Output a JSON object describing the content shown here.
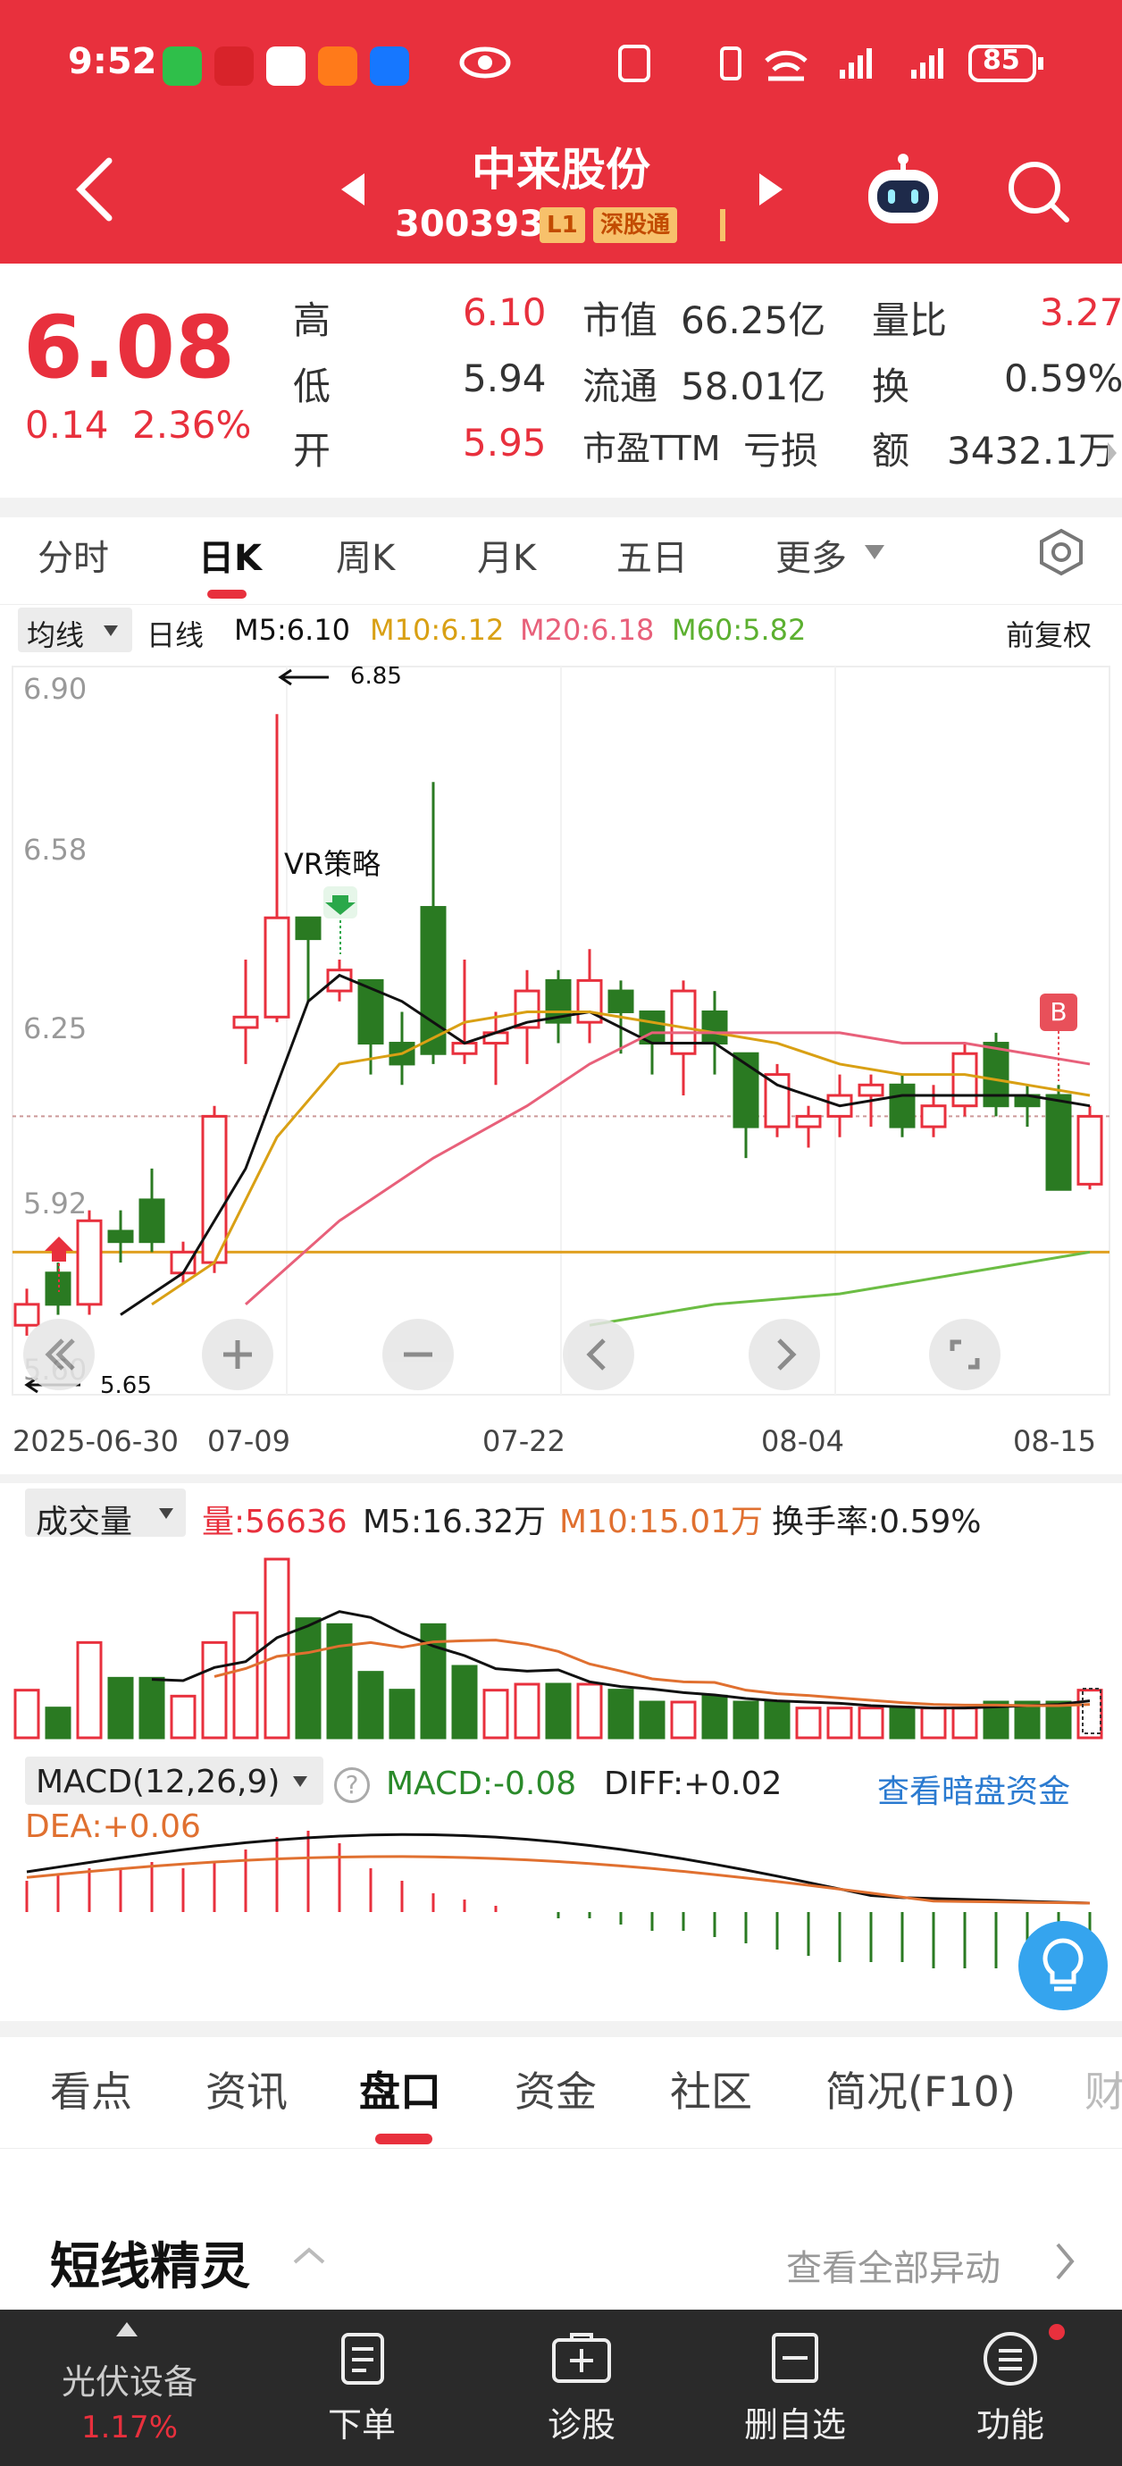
{
  "status": {
    "time": "9:52",
    "battery": "85"
  },
  "header": {
    "title": "中来股份",
    "code": "300393",
    "tag_level": "L1",
    "tag_market": "深股通"
  },
  "quote": {
    "price": "6.08",
    "change": "0.14",
    "change_pct": "2.36%",
    "high_label": "高",
    "high": "6.10",
    "low_label": "低",
    "low": "5.94",
    "open_label": "开",
    "open": "5.95",
    "mcap_label": "市值",
    "mcap": "66.25亿",
    "float_label": "流通",
    "float": "58.01亿",
    "pe_label": "市盈TTM",
    "pe": "亏损",
    "vr_label": "量比",
    "vr": "3.27",
    "turn_label": "换",
    "turn": "0.59%",
    "amt_label": "额",
    "amt": "3432.1万"
  },
  "chart_tabs": [
    "分时",
    "日K",
    "周K",
    "月K",
    "五日",
    "更多"
  ],
  "ma_bar": {
    "indicator": "均线",
    "type": "日线",
    "m5": "M5:6.10",
    "m10": "M10:6.12",
    "m20": "M20:6.18",
    "m60": "M60:5.82",
    "adjust": "前复权"
  },
  "colors": {
    "up": "#e8303d",
    "down": "#2a7a22",
    "m5": "#111111",
    "m10": "#d9a014",
    "m20": "#e8607a",
    "m60": "#6cbd44"
  },
  "chart_data": [
    {
      "type": "candlestick",
      "y_ticks": [
        "6.90",
        "6.58",
        "6.25",
        "5.92",
        "5.60"
      ],
      "ylim": [
        5.6,
        6.9
      ],
      "x_ticks": [
        "2025-06-30",
        "07-09",
        "07-22",
        "08-04",
        "08-15"
      ],
      "annotations": {
        "high_mark": "6.85",
        "low_mark": "5.65",
        "strategy": "VR策略",
        "buy_tag": "B"
      },
      "candles": [
        {
          "o": 5.68,
          "h": 5.75,
          "l": 5.66,
          "c": 5.72
        },
        {
          "o": 5.78,
          "h": 5.8,
          "l": 5.7,
          "c": 5.72
        },
        {
          "o": 5.72,
          "h": 5.9,
          "l": 5.7,
          "c": 5.88
        },
        {
          "o": 5.86,
          "h": 5.9,
          "l": 5.8,
          "c": 5.84
        },
        {
          "o": 5.92,
          "h": 5.98,
          "l": 5.82,
          "c": 5.84
        },
        {
          "o": 5.78,
          "h": 5.84,
          "l": 5.76,
          "c": 5.82
        },
        {
          "o": 5.8,
          "h": 6.1,
          "l": 5.78,
          "c": 6.08
        },
        {
          "o": 6.25,
          "h": 6.38,
          "l": 6.18,
          "c": 6.27
        },
        {
          "o": 6.27,
          "h": 6.85,
          "l": 6.26,
          "c": 6.46
        },
        {
          "o": 6.46,
          "h": 6.46,
          "l": 6.3,
          "c": 6.42
        },
        {
          "o": 6.32,
          "h": 6.38,
          "l": 6.3,
          "c": 6.36
        },
        {
          "o": 6.34,
          "h": 6.34,
          "l": 6.16,
          "c": 6.22
        },
        {
          "o": 6.22,
          "h": 6.28,
          "l": 6.14,
          "c": 6.18
        },
        {
          "o": 6.48,
          "h": 6.72,
          "l": 6.18,
          "c": 6.2
        },
        {
          "o": 6.2,
          "h": 6.38,
          "l": 6.18,
          "c": 6.22
        },
        {
          "o": 6.22,
          "h": 6.28,
          "l": 6.14,
          "c": 6.24
        },
        {
          "o": 6.25,
          "h": 6.36,
          "l": 6.18,
          "c": 6.32
        },
        {
          "o": 6.34,
          "h": 6.36,
          "l": 6.22,
          "c": 6.26
        },
        {
          "o": 6.26,
          "h": 6.4,
          "l": 6.22,
          "c": 6.34
        },
        {
          "o": 6.32,
          "h": 6.34,
          "l": 6.2,
          "c": 6.28
        },
        {
          "o": 6.28,
          "h": 6.28,
          "l": 6.16,
          "c": 6.22
        },
        {
          "o": 6.2,
          "h": 6.34,
          "l": 6.12,
          "c": 6.32
        },
        {
          "o": 6.28,
          "h": 6.32,
          "l": 6.16,
          "c": 6.22
        },
        {
          "o": 6.2,
          "h": 6.2,
          "l": 6.0,
          "c": 6.06
        },
        {
          "o": 6.06,
          "h": 6.18,
          "l": 6.04,
          "c": 6.16
        },
        {
          "o": 6.06,
          "h": 6.1,
          "l": 6.02,
          "c": 6.08
        },
        {
          "o": 6.08,
          "h": 6.16,
          "l": 6.04,
          "c": 6.12
        },
        {
          "o": 6.12,
          "h": 6.16,
          "l": 6.06,
          "c": 6.14
        },
        {
          "o": 6.14,
          "h": 6.16,
          "l": 6.04,
          "c": 6.06
        },
        {
          "o": 6.06,
          "h": 6.14,
          "l": 6.04,
          "c": 6.1
        },
        {
          "o": 6.1,
          "h": 6.22,
          "l": 6.08,
          "c": 6.2
        },
        {
          "o": 6.22,
          "h": 6.24,
          "l": 6.08,
          "c": 6.1
        },
        {
          "o": 6.12,
          "h": 6.14,
          "l": 6.06,
          "c": 6.1
        },
        {
          "o": 6.12,
          "h": 6.14,
          "l": 5.94,
          "c": 5.94
        },
        {
          "o": 5.95,
          "h": 6.1,
          "l": 5.94,
          "c": 6.08
        }
      ],
      "series": [
        {
          "name": "M5",
          "points": [
            [
              3,
              5.7
            ],
            [
              5,
              5.78
            ],
            [
              7,
              5.98
            ],
            [
              9,
              6.3
            ],
            [
              10,
              6.35
            ],
            [
              12,
              6.3
            ],
            [
              14,
              6.22
            ],
            [
              16,
              6.26
            ],
            [
              18,
              6.28
            ],
            [
              20,
              6.22
            ],
            [
              22,
              6.22
            ],
            [
              24,
              6.14
            ],
            [
              26,
              6.1
            ],
            [
              28,
              6.12
            ],
            [
              30,
              6.12
            ],
            [
              32,
              6.12
            ],
            [
              34,
              6.1
            ]
          ]
        },
        {
          "name": "M10",
          "points": [
            [
              4,
              5.72
            ],
            [
              6,
              5.8
            ],
            [
              8,
              6.04
            ],
            [
              10,
              6.18
            ],
            [
              12,
              6.2
            ],
            [
              14,
              6.26
            ],
            [
              16,
              6.28
            ],
            [
              18,
              6.28
            ],
            [
              20,
              6.26
            ],
            [
              22,
              6.24
            ],
            [
              24,
              6.22
            ],
            [
              26,
              6.18
            ],
            [
              28,
              6.16
            ],
            [
              30,
              6.16
            ],
            [
              32,
              6.14
            ],
            [
              34,
              6.12
            ]
          ]
        },
        {
          "name": "M20",
          "points": [
            [
              7,
              5.72
            ],
            [
              10,
              5.88
            ],
            [
              13,
              6.0
            ],
            [
              16,
              6.1
            ],
            [
              18,
              6.18
            ],
            [
              20,
              6.24
            ],
            [
              22,
              6.24
            ],
            [
              24,
              6.24
            ],
            [
              26,
              6.24
            ],
            [
              28,
              6.22
            ],
            [
              30,
              6.22
            ],
            [
              32,
              6.2
            ],
            [
              34,
              6.18
            ]
          ]
        },
        {
          "name": "M60",
          "points": [
            [
              18,
              5.68
            ],
            [
              22,
              5.72
            ],
            [
              26,
              5.74
            ],
            [
              30,
              5.78
            ],
            [
              34,
              5.82
            ]
          ]
        }
      ]
    },
    {
      "type": "bar",
      "title": "成交量",
      "labels": {
        "vol": "量:56636",
        "m5": "M5:16.32万",
        "m10": "M10:15.01万",
        "turn": "换手率:0.59%"
      },
      "values": [
        8,
        5,
        16,
        10,
        10,
        7,
        16,
        21,
        30,
        20,
        19,
        11,
        8,
        19,
        12,
        8,
        9,
        9,
        9,
        8,
        6,
        6,
        7,
        6,
        6,
        5,
        5,
        5,
        5,
        5,
        5,
        6,
        6,
        6,
        8
      ],
      "up": [
        true,
        false,
        true,
        false,
        false,
        true,
        true,
        true,
        true,
        false,
        false,
        false,
        false,
        false,
        false,
        true,
        true,
        false,
        true,
        false,
        false,
        true,
        false,
        false,
        false,
        true,
        true,
        true,
        false,
        true,
        true,
        false,
        false,
        false,
        true
      ]
    },
    {
      "type": "bar",
      "title": "MACD(12,26,9)",
      "labels": {
        "macd": "MACD:-0.08",
        "diff": "DIFF:+0.02",
        "dea": "DEA:+0.06",
        "link": "查看暗盘资金"
      },
      "values": [
        0.05,
        0.06,
        0.07,
        0.07,
        0.08,
        0.07,
        0.08,
        0.1,
        0.12,
        0.13,
        0.11,
        0.07,
        0.05,
        0.03,
        0.02,
        0.01,
        0.0,
        -0.01,
        -0.01,
        -0.02,
        -0.03,
        -0.03,
        -0.04,
        -0.05,
        -0.06,
        -0.07,
        -0.08,
        -0.08,
        -0.08,
        -0.09,
        -0.09,
        -0.09,
        -0.08,
        -0.09,
        -0.08
      ]
    }
  ],
  "bottom_tabs": [
    "看点",
    "资讯",
    "盘口",
    "资金",
    "社区",
    "简况(F10)",
    "财"
  ],
  "section": {
    "title": "短线精灵",
    "link": "查看全部异动"
  },
  "bottom_bar": {
    "sector": "光伏设备",
    "sector_pct": "1.17%",
    "order": "下单",
    "diagnose": "诊股",
    "remove": "删自选",
    "func": "功能"
  }
}
